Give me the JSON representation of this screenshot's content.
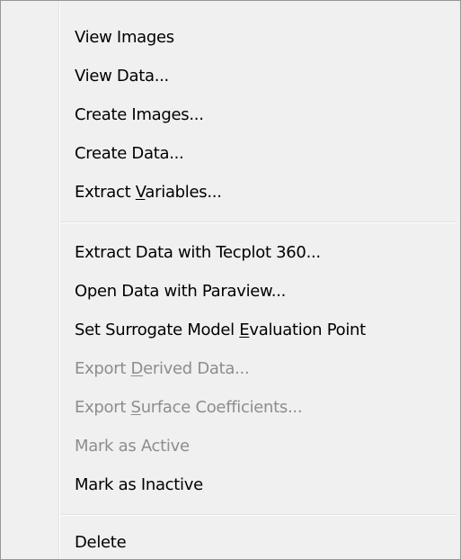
{
  "menu": {
    "items": [
      {
        "pre": "View Images",
        "ul": "",
        "post": "",
        "enabled": true
      },
      {
        "pre": "View Data...",
        "ul": "",
        "post": "",
        "enabled": true
      },
      {
        "pre": "Create Images...",
        "ul": "",
        "post": "",
        "enabled": true
      },
      {
        "pre": "Create Data...",
        "ul": "",
        "post": "",
        "enabled": true
      },
      {
        "pre": "Extract ",
        "ul": "V",
        "post": "ariables...",
        "enabled": true
      },
      {
        "pre": "Extract Data with Tecplot 360...",
        "ul": "",
        "post": "",
        "enabled": true
      },
      {
        "pre": "Open Data with Paraview...",
        "ul": "",
        "post": "",
        "enabled": true
      },
      {
        "pre": "Set Surrogate Model ",
        "ul": "E",
        "post": "valuation Point",
        "enabled": true
      },
      {
        "pre": "Export ",
        "ul": "D",
        "post": "erived Data...",
        "enabled": false
      },
      {
        "pre": "Export ",
        "ul": "S",
        "post": "urface Coefficients...",
        "enabled": false
      },
      {
        "pre": "Mark as Active",
        "ul": "",
        "post": "",
        "enabled": false
      },
      {
        "pre": "Mark as Inactive",
        "ul": "",
        "post": "",
        "enabled": true
      },
      {
        "pre": "Delete",
        "ul": "",
        "post": "",
        "enabled": true
      }
    ]
  }
}
